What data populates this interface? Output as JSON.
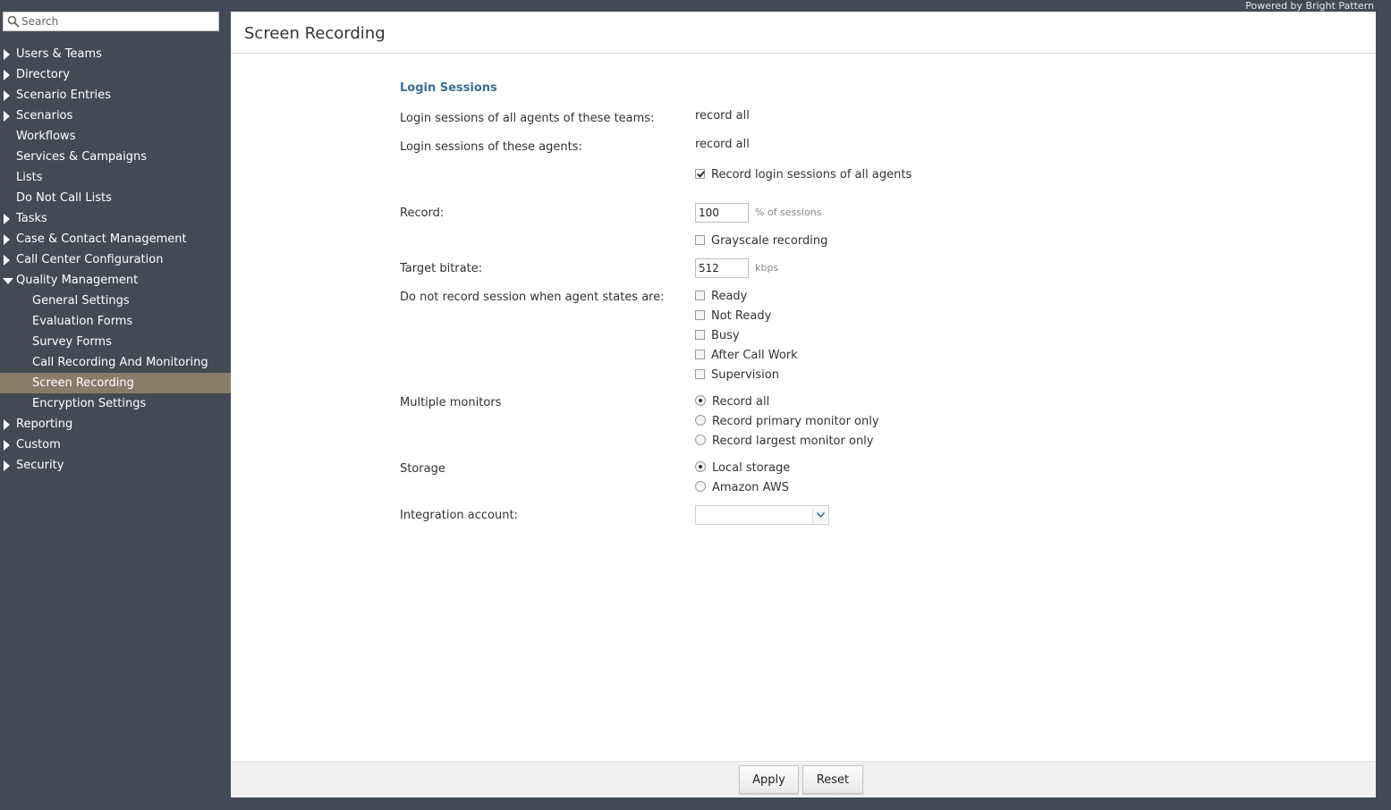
{
  "branding": {
    "powered_by": "Powered by Bright Pattern"
  },
  "search": {
    "placeholder": "Search"
  },
  "sidebar": {
    "items": [
      {
        "label": "Users & Teams",
        "expander": "collapsed"
      },
      {
        "label": "Directory",
        "expander": "collapsed"
      },
      {
        "label": "Scenario Entries",
        "expander": "collapsed"
      },
      {
        "label": "Scenarios",
        "expander": "collapsed"
      },
      {
        "label": "Workflows",
        "expander": "none"
      },
      {
        "label": "Services & Campaigns",
        "expander": "none"
      },
      {
        "label": "Lists",
        "expander": "none"
      },
      {
        "label": "Do Not Call Lists",
        "expander": "none"
      },
      {
        "label": "Tasks",
        "expander": "collapsed"
      },
      {
        "label": "Case & Contact Management",
        "expander": "collapsed"
      },
      {
        "label": "Call Center Configuration",
        "expander": "collapsed"
      },
      {
        "label": "Quality Management",
        "expander": "expanded"
      },
      {
        "label": "General Settings",
        "child": true
      },
      {
        "label": "Evaluation Forms",
        "child": true
      },
      {
        "label": "Survey Forms",
        "child": true
      },
      {
        "label": "Call Recording And Monitoring",
        "child": true
      },
      {
        "label": "Screen Recording",
        "child": true,
        "active": true
      },
      {
        "label": "Encryption Settings",
        "child": true
      },
      {
        "label": "Reporting",
        "expander": "collapsed"
      },
      {
        "label": "Custom",
        "expander": "collapsed"
      },
      {
        "label": "Security",
        "expander": "collapsed"
      }
    ]
  },
  "page": {
    "title": "Screen Recording"
  },
  "form": {
    "section_title": "Login Sessions",
    "teams_label": "Login sessions of all agents of these teams:",
    "teams_value": "record all",
    "agents_label": "Login sessions of these agents:",
    "agents_value": "record all",
    "record_all_agents_label": "Record login sessions of all agents",
    "record_all_agents_checked": true,
    "record_label": "Record:",
    "record_value": "100",
    "record_unit": "% of sessions",
    "grayscale_label": "Grayscale recording",
    "grayscale_checked": false,
    "bitrate_label": "Target bitrate:",
    "bitrate_value": "512",
    "bitrate_unit": "kbps",
    "agent_states_label": "Do not record session when agent states are:",
    "agent_states": [
      {
        "label": "Ready",
        "checked": false
      },
      {
        "label": "Not Ready",
        "checked": false
      },
      {
        "label": "Busy",
        "checked": false
      },
      {
        "label": "After Call Work",
        "checked": false
      },
      {
        "label": "Supervision",
        "checked": false
      }
    ],
    "monitors_label": "Multiple monitors",
    "monitors": [
      {
        "label": "Record all",
        "selected": true
      },
      {
        "label": "Record primary monitor only",
        "selected": false
      },
      {
        "label": "Record largest monitor only",
        "selected": false
      }
    ],
    "storage_label": "Storage",
    "storage": [
      {
        "label": "Local storage",
        "selected": true
      },
      {
        "label": "Amazon AWS",
        "selected": false
      }
    ],
    "integration_label": "Integration account:",
    "integration_value": ""
  },
  "footer": {
    "apply_label": "Apply",
    "reset_label": "Reset"
  },
  "colors": {
    "sidebar_bg": "#434a54",
    "active_item_bg": "#8a7d68",
    "section_title": "#3b6d99"
  }
}
